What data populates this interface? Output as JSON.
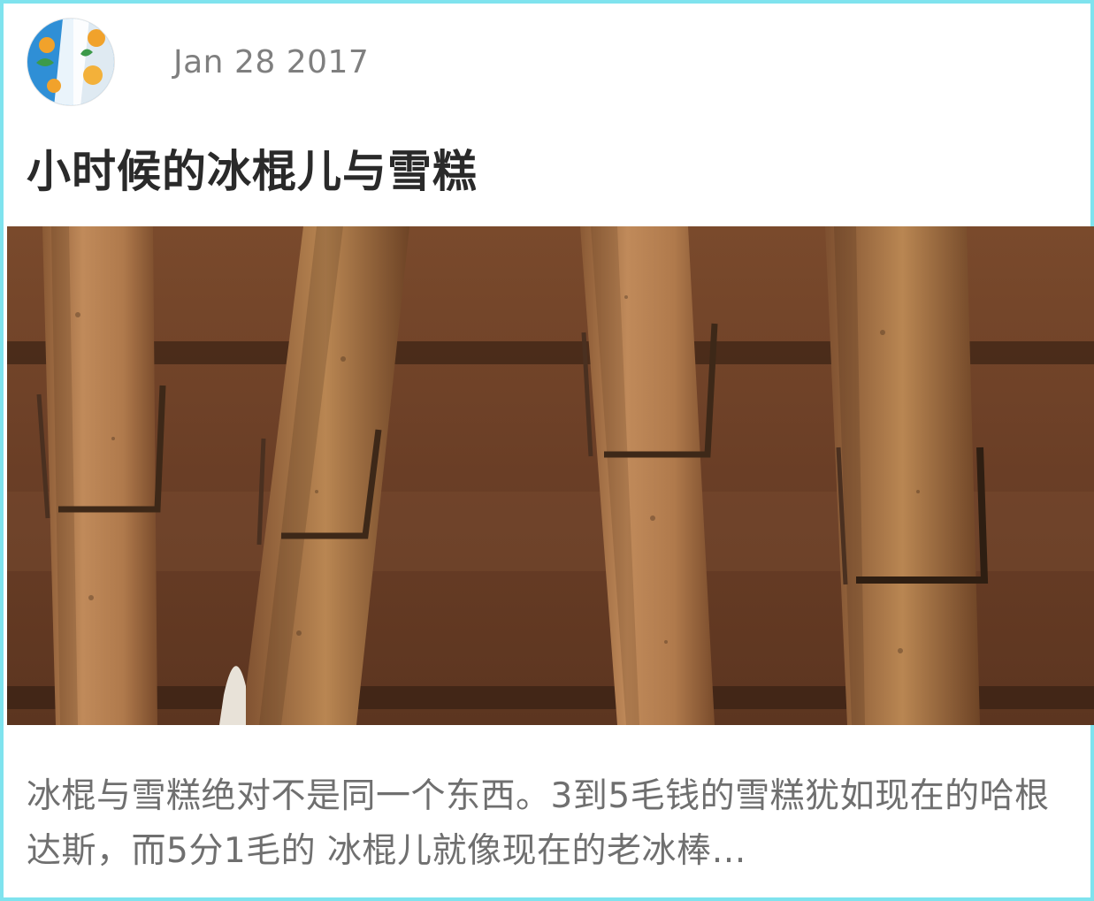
{
  "post": {
    "date": "Jan 28 2017",
    "title": "小时候的冰棍儿与雪糕",
    "excerpt": "冰棍与雪糕绝对不是同一个东西。3到5毛钱的雪糕犹如现在的哈根达斯，而5分1毛的 冰棍儿就像现在的老冰棒…",
    "author_avatar": "avatar-image",
    "cover_image": "wooden-clothespins-photo"
  },
  "colors": {
    "border": "#7fe3ee",
    "date": "#7f7f7f",
    "title": "#2a2a2a",
    "excerpt": "#6f6f6f",
    "photo_background": "#6a4027"
  }
}
